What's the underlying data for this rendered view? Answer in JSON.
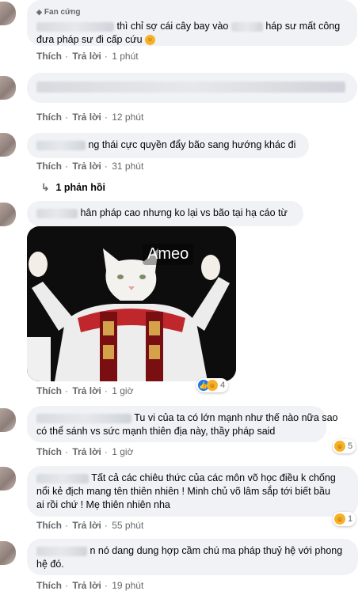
{
  "comments": [
    {
      "badge": "Fan cứng",
      "line1": "thì chỉ sợ cái cây bay vào",
      "line1b": "háp sư mất công",
      "line2": "đưa pháp sư đi cấp cứu",
      "actions": {
        "like": "Thích",
        "reply": "Trả lời",
        "time": "1 phút"
      }
    },
    {
      "actions": {
        "like": "Thích",
        "reply": "Trả lời",
        "time": "12 phút"
      }
    },
    {
      "text": "ng thái cực quyền đẩy bão sang hướng khác đi",
      "actions": {
        "like": "Thích",
        "reply": "Trả lời",
        "time": "31 phút"
      },
      "replies": "1 phản hồi"
    },
    {
      "text": "hân pháp cao nhưng ko lại vs bão tại hạ cáo từ",
      "meme_caption": "Ameo",
      "actions": {
        "like": "Thích",
        "reply": "Trả lời",
        "time": "1 giờ"
      },
      "reaction_count": "4"
    },
    {
      "line1": "Tu vi của ta có lớn mạnh như thế nào nữa sao",
      "line2": "có thể sánh vs sức mạnh thiên địa này, thầy pháp said",
      "actions": {
        "like": "Thích",
        "reply": "Trả lời",
        "time": "1 giờ"
      },
      "reaction_count": "5"
    },
    {
      "line1": "Tất cả các chiêu thức của các môn võ học điều k chống",
      "line2": "nổi kẻ địch mang tên thiên nhiên ! Minh chủ võ lâm sắp tới biết bầu",
      "line3": "ai rồi chứ ! Mẹ thiên nhiên nha",
      "actions": {
        "like": "Thích",
        "reply": "Trả lời",
        "time": "55 phút"
      },
      "reaction_count": "1"
    },
    {
      "line1": "n nó dang dung hợp cầm chú ma pháp thuỷ hệ với phong",
      "line2": "hệ đó.",
      "actions": {
        "like": "Thích",
        "reply": "Trả lời",
        "time": "19 phút"
      }
    }
  ],
  "icons": {
    "badge": "diamond-icon",
    "reply_arrow": "reply-arrow-icon",
    "emoji": "haha-emoji",
    "like": "like-icon"
  },
  "colors": {
    "bubble": "#f0f2f5",
    "meta": "#65676b",
    "like_blue": "#1877f2",
    "haha_yellow": "#f7b125"
  }
}
